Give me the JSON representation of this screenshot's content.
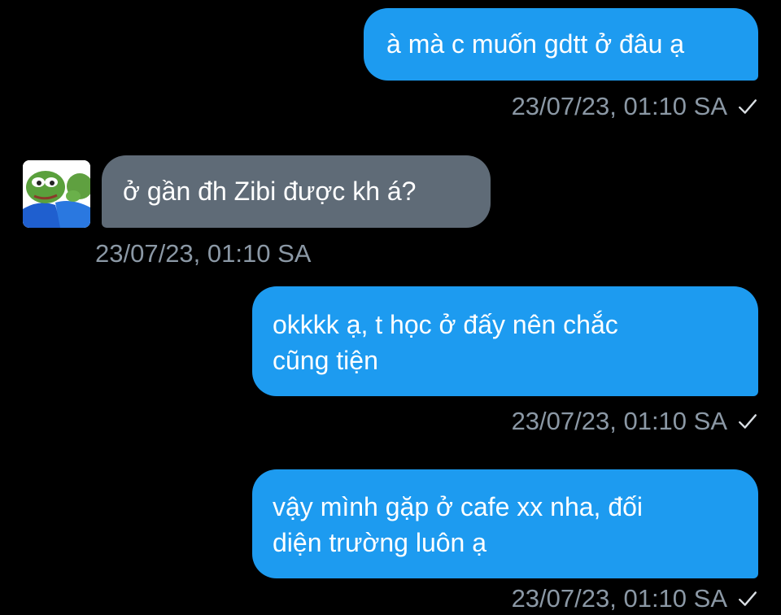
{
  "colors": {
    "background": "#000000",
    "outgoing_bubble": "#1d9bf0",
    "incoming_bubble": "#5f6b77",
    "timestamp": "#8b98a5"
  },
  "messages": [
    {
      "direction": "outgoing",
      "text": "à mà c muốn gdtt ở đâu ạ",
      "timestamp": "23/07/23, 01:10 SA",
      "status_icon": "check-icon"
    },
    {
      "direction": "incoming",
      "avatar_icon": "pepe-avatar",
      "text": "ở gần đh Zibi được kh á?",
      "timestamp": "23/07/23, 01:10 SA"
    },
    {
      "direction": "outgoing",
      "text": "okkkk ạ, t học ở đấy nên chắc\ncũng tiện",
      "timestamp": "23/07/23, 01:10 SA",
      "status_icon": "check-icon"
    },
    {
      "direction": "outgoing",
      "text": "vậy mình gặp ở cafe xx nha, đối\ndiện trường luôn ạ",
      "timestamp": "23/07/23, 01:10 SA",
      "status_icon": "check-icon"
    }
  ]
}
